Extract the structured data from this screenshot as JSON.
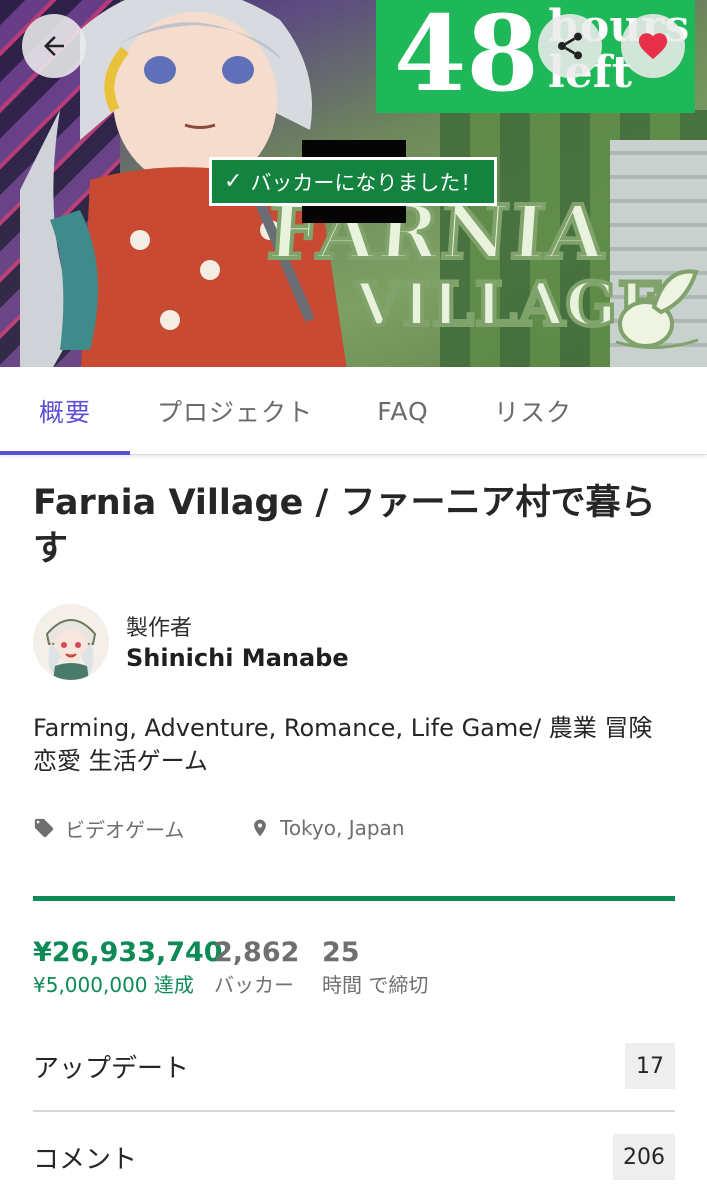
{
  "hero": {
    "timer_number": "48",
    "timer_unit_line1": "hours",
    "timer_unit_line2": "left",
    "title_line1": "FARNIA",
    "title_line2": "VILLAGE",
    "backer_badge": "バッカーになりました！",
    "icons": [
      "back-arrow-icon",
      "share-icon",
      "heart-icon",
      "check-icon"
    ],
    "accent_green": "#1fb858",
    "badge_green": "#14833f",
    "like_red": "#e8304a"
  },
  "tabs": [
    {
      "label": "概要",
      "active": true
    },
    {
      "label": "プロジェクト",
      "active": false
    },
    {
      "label": "FAQ",
      "active": false
    },
    {
      "label": "リスク",
      "active": false
    }
  ],
  "tab_accent": "#5b4fd6",
  "project": {
    "title": "Farnia Village / ファーニア村で暮らす",
    "creator_role": "製作者",
    "creator_name": "Shinichi Manabe",
    "blurb": "Farming, Adventure, Romance, Life Game/ 農業 冒険 恋愛 生活ゲーム",
    "category": "ビデオゲーム",
    "location": "Tokyo, Japan"
  },
  "stats": {
    "pledged": "¥26,933,740",
    "goal": "¥5,000,000 達成",
    "backers": "2,862",
    "backers_label": "バッカー",
    "time_left": "25",
    "time_left_label": "時間 で締切",
    "funded_progress": 1.0,
    "funded_color": "#0e8a57"
  },
  "sections": {
    "updates_label": "アップデート",
    "updates_count": "17",
    "comments_label": "コメント",
    "comments_count": "206"
  }
}
